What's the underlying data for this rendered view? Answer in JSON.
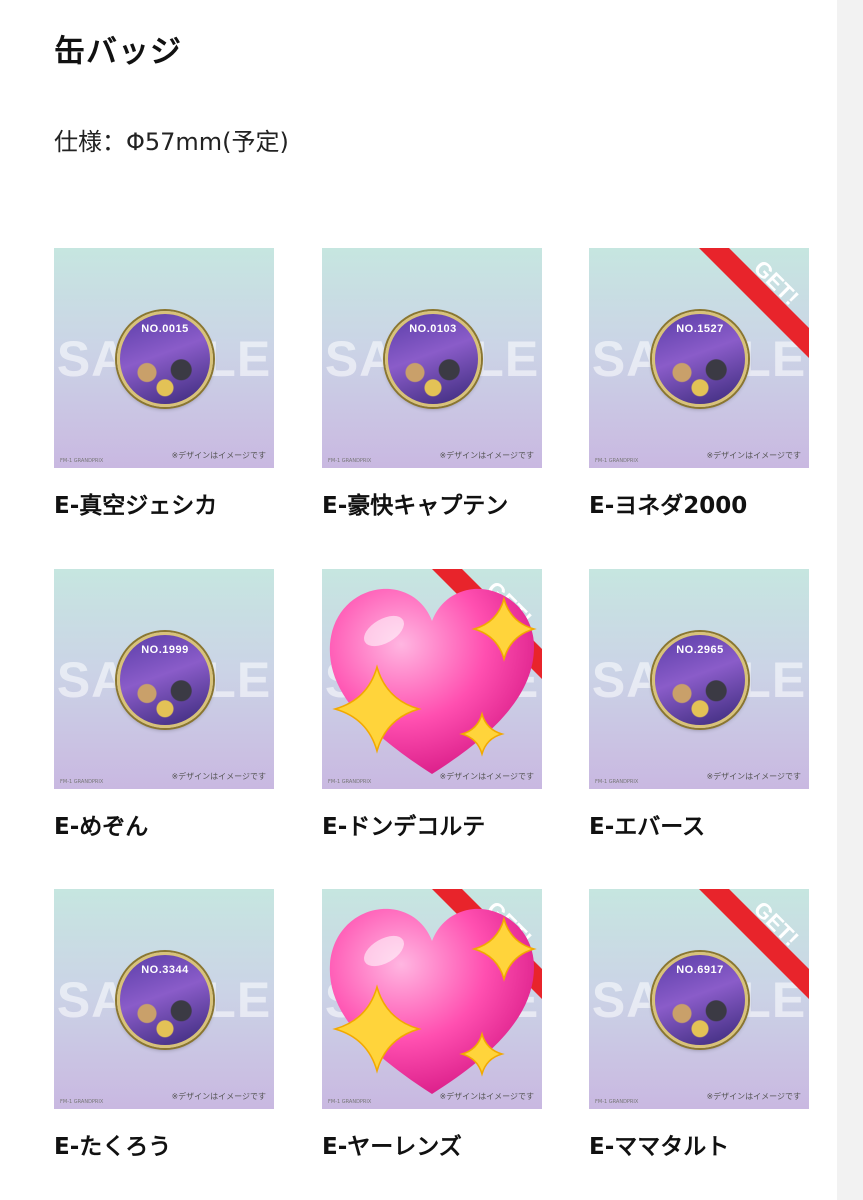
{
  "section": {
    "title": "缶バッジ",
    "spec": "仕様：Φ57mm(予定)"
  },
  "common": {
    "watermark": "SAMPLE",
    "note": "※デザインはイメージです",
    "small_logo": "FM-1 GRANDPRIX",
    "get_label": "GET!"
  },
  "items": [
    {
      "name": "E-真空ジェシカ",
      "number": "NO.0015",
      "get": false,
      "heart": false
    },
    {
      "name": "E-豪快キャプテン",
      "number": "NO.0103",
      "get": false,
      "heart": false
    },
    {
      "name": "E-ヨネダ2000",
      "number": "NO.1527",
      "get": true,
      "heart": false
    },
    {
      "name": "E-めぞん",
      "number": "NO.1999",
      "get": false,
      "heart": false
    },
    {
      "name": "E-ドンデコルテ",
      "number": "",
      "get": true,
      "heart": true
    },
    {
      "name": "E-エバース",
      "number": "NO.2965",
      "get": false,
      "heart": false
    },
    {
      "name": "E-たくろう",
      "number": "NO.3344",
      "get": false,
      "heart": false
    },
    {
      "name": "E-ヤーレンズ",
      "number": "",
      "get": true,
      "heart": true
    },
    {
      "name": "E-ママタルト",
      "number": "NO.6917",
      "get": true,
      "heart": false
    }
  ],
  "colors": {
    "get_ribbon": "#e8242b",
    "heart": "#ff4fb0",
    "sparkle": "#ffd43b"
  }
}
